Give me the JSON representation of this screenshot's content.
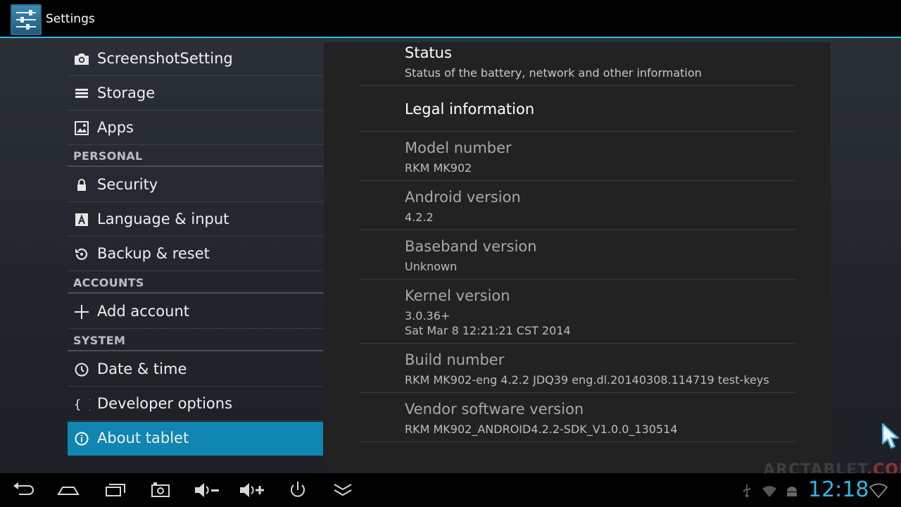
{
  "app": {
    "title": "Settings",
    "icon": "settings-sliders-icon"
  },
  "nav": {
    "items_top": [
      {
        "label": "ScreenshotSetting",
        "icon": "camera-icon"
      },
      {
        "label": "Storage",
        "icon": "storage-icon"
      },
      {
        "label": "Apps",
        "icon": "apps-icon"
      }
    ],
    "section_personal": "PERSONAL",
    "items_personal": [
      {
        "label": "Security",
        "icon": "lock-icon"
      },
      {
        "label": "Language & input",
        "icon": "language-icon"
      },
      {
        "label": "Backup & reset",
        "icon": "backup-icon"
      }
    ],
    "section_accounts": "ACCOUNTS",
    "items_accounts": [
      {
        "label": "Add account",
        "icon": "plus-icon"
      }
    ],
    "section_system": "SYSTEM",
    "items_system": [
      {
        "label": "Date & time",
        "icon": "clock-icon"
      },
      {
        "label": "Developer options",
        "icon": "braces-icon"
      },
      {
        "label": "About tablet",
        "icon": "info-icon",
        "selected": true
      }
    ]
  },
  "about": {
    "status": {
      "title": "Status",
      "summary": "Status of the battery, network and other information"
    },
    "legal": {
      "title": "Legal information"
    },
    "model": {
      "title": "Model number",
      "value": "RKM MK902"
    },
    "android": {
      "title": "Android version",
      "value": "4.2.2"
    },
    "baseband": {
      "title": "Baseband version",
      "value": "Unknown"
    },
    "kernel": {
      "title": "Kernel version",
      "value_line1": "3.0.36+",
      "value_line2": "Sat Mar 8 12:21:21 CST 2014"
    },
    "build": {
      "title": "Build number",
      "value": "RKM MK902-eng 4.2.2 JDQ39 eng.dl.20140308.114719 test-keys"
    },
    "vendor": {
      "title": "Vendor software version",
      "value": "RKM MK902_ANDROID4.2.2-SDK_V1.0.0_130514"
    }
  },
  "watermark": {
    "main": "ARCTABLET",
    "suffix": ".COM"
  },
  "system_bar": {
    "buttons": [
      "back-icon",
      "home-icon",
      "recent-apps-icon",
      "screenshot-icon",
      "volume-down-icon",
      "volume-up-icon",
      "power-icon",
      "hide-bar-icon"
    ],
    "status_icons": [
      "usb-icon",
      "wifi-icon",
      "android-debug-icon"
    ],
    "time": "12:18"
  },
  "colors": {
    "accent": "#33b5e5",
    "selected": "#0f85b2",
    "panel": "#222222"
  }
}
